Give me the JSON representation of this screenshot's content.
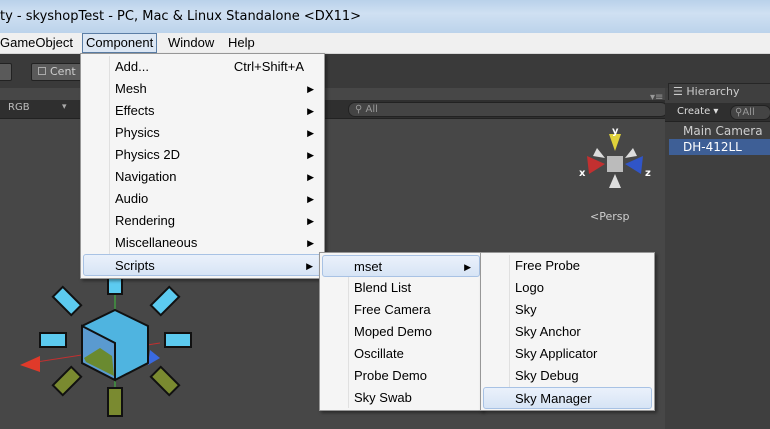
{
  "window": {
    "title": "ty - skyshopTest - PC, Mac & Linux Standalone <DX11>"
  },
  "menubar": [
    "GameObject",
    "Component",
    "Window",
    "Help"
  ],
  "toolbar": {
    "center_label": "Cent"
  },
  "scene": {
    "color_mode": "RGB",
    "search_placeholder": "All",
    "camera_mode": "Persp",
    "gizmo_axes": {
      "y": "y",
      "x": "x",
      "z": "z"
    }
  },
  "hierarchy": {
    "tab": "Hierarchy",
    "create_label": "Create",
    "search_placeholder": "All",
    "items": [
      "Main Camera",
      "DH-412LL"
    ]
  },
  "component_menu": {
    "items": [
      {
        "label": "Add...",
        "shortcut": "Ctrl+Shift+A"
      },
      {
        "label": "Mesh"
      },
      {
        "label": "Effects"
      },
      {
        "label": "Physics"
      },
      {
        "label": "Physics 2D"
      },
      {
        "label": "Navigation"
      },
      {
        "label": "Audio"
      },
      {
        "label": "Rendering"
      },
      {
        "label": "Miscellaneous"
      },
      {
        "label": "Scripts"
      }
    ]
  },
  "scripts_menu": {
    "items": [
      "mset",
      "Blend List",
      "Free Camera",
      "Moped Demo",
      "Oscillate",
      "Probe Demo",
      "Sky Swab"
    ]
  },
  "mset_menu": {
    "items": [
      "Free Probe",
      "Logo",
      "Sky",
      "Sky Anchor",
      "Sky Applicator",
      "Sky Debug",
      "Sky Manager"
    ]
  },
  "colors": {
    "selection": "#3e5f96",
    "menu_bg": "#f5f5f5",
    "scene_bg": "#474747"
  }
}
